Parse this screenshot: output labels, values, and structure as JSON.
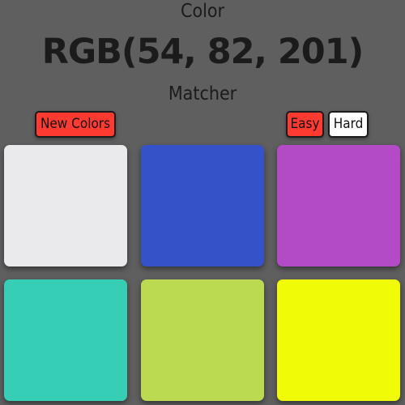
{
  "header": {
    "line1": "Color",
    "target": "RGB(54, 82, 201)",
    "line2": "Matcher"
  },
  "controls": {
    "new_colors": "New Colors",
    "easy": "Easy",
    "hard": "Hard"
  },
  "squares": [
    {
      "color": "#eaeaec"
    },
    {
      "color": "#3652c9"
    },
    {
      "color": "#b44bc6"
    },
    {
      "color": "#36cfb6"
    },
    {
      "color": "#bcd952"
    },
    {
      "color": "#f0fb08"
    }
  ]
}
